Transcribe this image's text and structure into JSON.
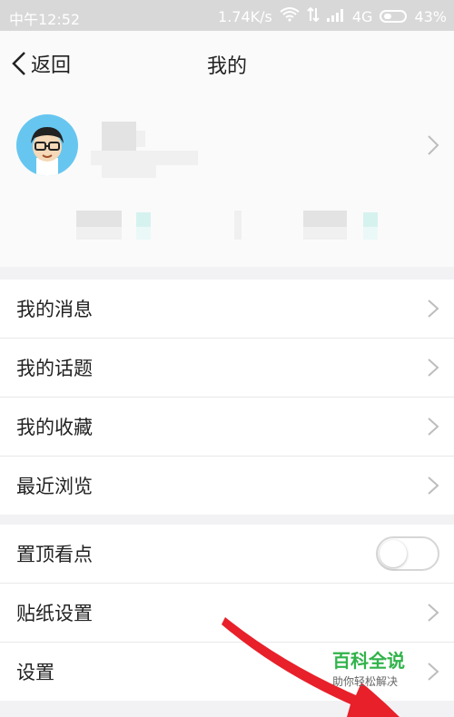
{
  "status_bar": {
    "time": "中午12:52",
    "speed": "1.74K/s",
    "network": "4G",
    "battery": "43%"
  },
  "nav": {
    "back_label": "返回",
    "title": "我的"
  },
  "menu_group1": [
    {
      "label": "我的消息"
    },
    {
      "label": "我的话题"
    },
    {
      "label": "我的收藏"
    },
    {
      "label": "最近浏览"
    }
  ],
  "menu_group2": [
    {
      "label": "置顶看点",
      "toggle_on": false
    },
    {
      "label": "贴纸设置"
    },
    {
      "label": "设置"
    }
  ],
  "watermark": {
    "title": "百科全说",
    "subtitle": "助你轻松解决"
  },
  "colors": {
    "accent_green": "#31b34a",
    "avatar_bg": "#66c6f0",
    "arrow_red": "#e8202a"
  }
}
